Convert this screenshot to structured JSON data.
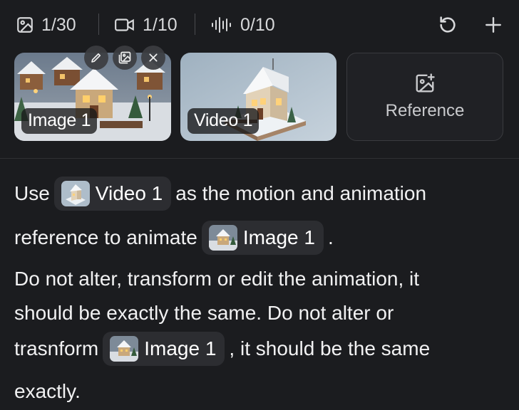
{
  "toolbar": {
    "images_count": "1/30",
    "videos_count": "1/10",
    "audio_count": "0/10",
    "icons": [
      "image-icon",
      "video-camera-icon",
      "audio-waveform-icon",
      "reset-icon",
      "plus-icon"
    ]
  },
  "media": {
    "image_label": "Image 1",
    "video_label": "Video 1",
    "reference_label": "Reference",
    "image_actions": [
      "edit-icon",
      "gallery-icon",
      "close-icon"
    ]
  },
  "prompt": {
    "line1_before": "Use",
    "chip_video": "Video 1",
    "line1_after": "as the motion and animation",
    "line2_before": "reference to animate",
    "chip_image_a": "Image 1",
    "line2_after": ".",
    "line3": "Do not alter, transform or edit the animation, it",
    "line4": "should be exactly the same. Do not alter or",
    "line5_before": "trasnform",
    "chip_image_b": "Image 1",
    "line5_after": ", it should be the same",
    "line6": "exactly."
  },
  "colors": {
    "background": "#1b1c1f",
    "chip": "#2c2d31",
    "text": "#f1f1f2"
  }
}
